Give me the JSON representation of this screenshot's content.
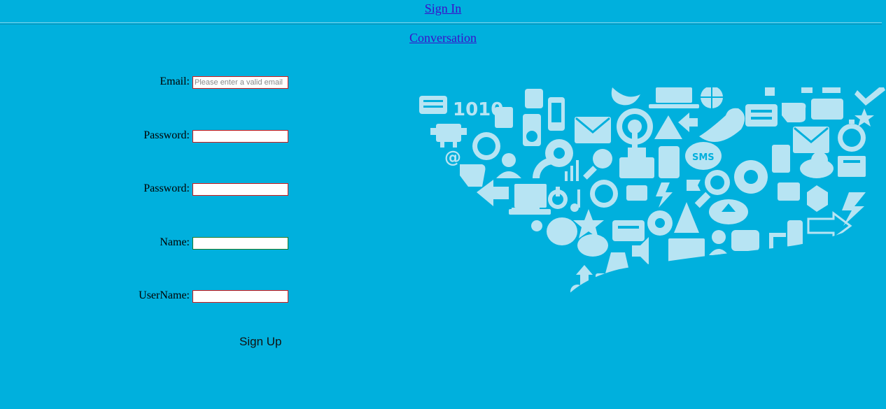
{
  "nav": {
    "signin_label": "Sign In",
    "conversation_label": "Conversation"
  },
  "form": {
    "email_label": "Email:",
    "email_placeholder": "Please enter a valid email",
    "password_label": "Password:",
    "password_confirm_label": "Password:",
    "name_label": "Name:",
    "username_label": "UserName:",
    "submit_label": "Sign Up"
  },
  "illustration": {
    "sms_text": "SMS",
    "binary_text": "1010",
    "at_text": "@"
  },
  "colors": {
    "background": "#00b0dd",
    "link": "#3a10c9",
    "invalid_border": "#d41a1a",
    "valid_border": "#1a7a2a",
    "icon": "#b7e4f3"
  }
}
